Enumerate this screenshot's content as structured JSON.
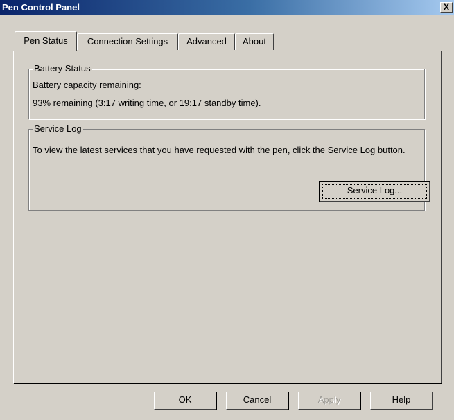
{
  "window": {
    "title": "Pen Control Panel",
    "close_glyph": "X"
  },
  "tabs": [
    {
      "label": "Pen Status",
      "active": true
    },
    {
      "label": "Connection Settings",
      "active": false
    },
    {
      "label": "Advanced",
      "active": false
    },
    {
      "label": "About",
      "active": false
    }
  ],
  "battery": {
    "group_label": "Battery Status",
    "capacity_label": "Battery capacity remaining:",
    "remaining_text": "93% remaining (3:17 writing time, or 19:17 standby time)."
  },
  "service_log": {
    "group_label": "Service Log",
    "description": "To view the latest services that you have requested with the pen, click the Service Log button.",
    "button_label": "Service Log..."
  },
  "footer": {
    "ok_label": "OK",
    "cancel_label": "Cancel",
    "apply_label": "Apply",
    "help_label": "Help"
  },
  "colors": {
    "dialog_face": "#d4d0c8",
    "title_active": "#0a246a"
  }
}
